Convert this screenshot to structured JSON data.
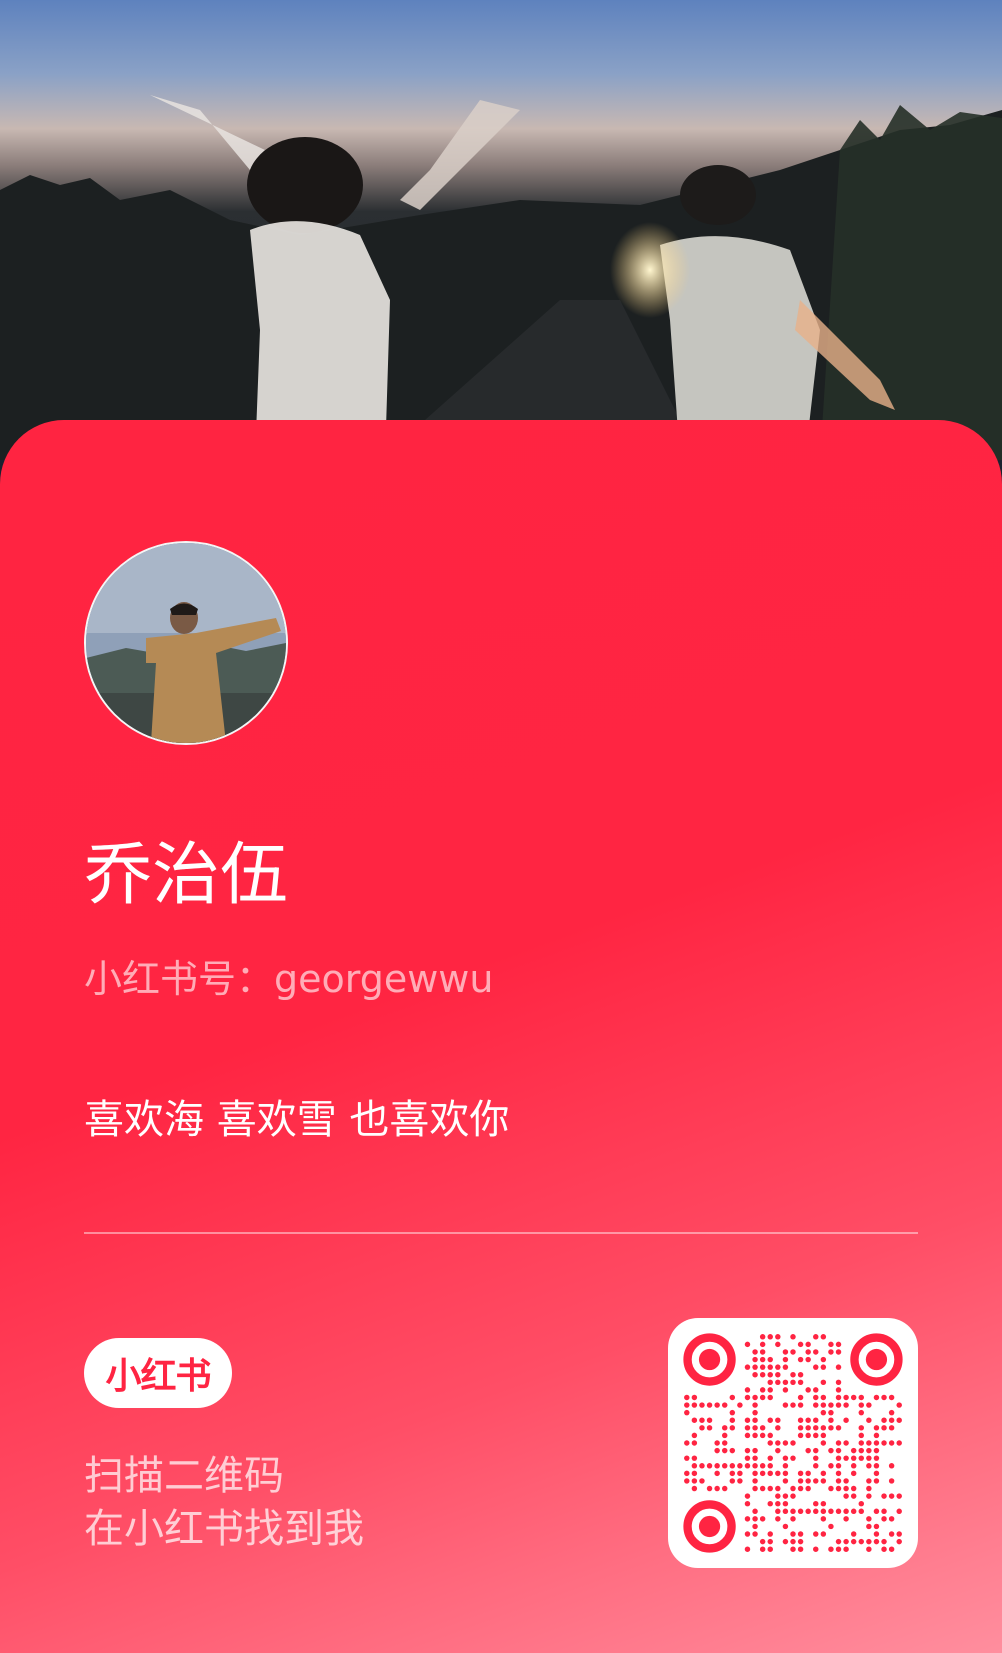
{
  "profile": {
    "name": "乔治伍",
    "id_line": "小红书号：georgewwu",
    "bio": "喜欢海 喜欢雪 也喜欢你"
  },
  "footer": {
    "logo_text": "小红书",
    "scan_line1": "扫描二维码",
    "scan_line2": "在小红书找到我"
  },
  "colors": {
    "brand_red": "#ff2442",
    "card_gradient_end": "#ff8e9e",
    "text_white": "#ffffff"
  },
  "icons": {
    "qr": "qr-code-icon",
    "logo": "xiaohongshu-logo"
  }
}
